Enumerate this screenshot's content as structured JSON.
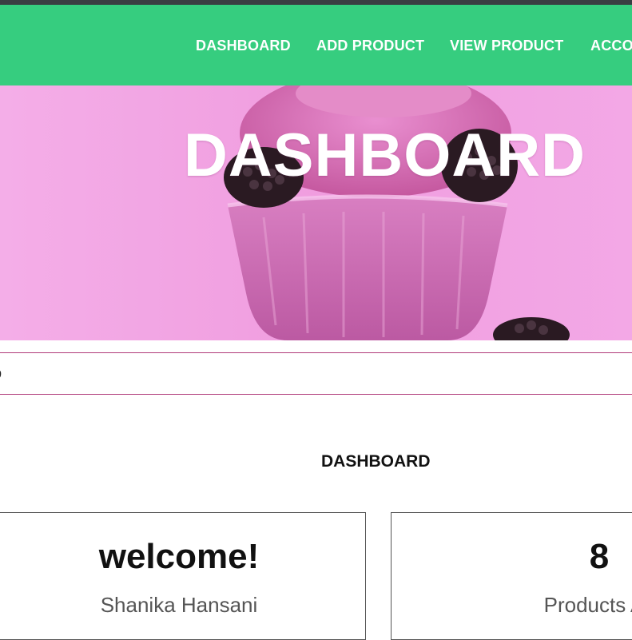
{
  "nav": {
    "items": [
      {
        "label": "DASHBOARD"
      },
      {
        "label": "ADD PRODUCT"
      },
      {
        "label": "VIEW PRODUCT"
      },
      {
        "label": "ACCO"
      }
    ]
  },
  "hero": {
    "title": "DASHBOARD"
  },
  "search": {
    "placeholder": "",
    "glyph": "p"
  },
  "main": {
    "section_title": "DASHBOARD",
    "cards": [
      {
        "big": "welcome!",
        "sub": "Shanika Hansani"
      },
      {
        "big": "8",
        "sub": "Products Ac"
      }
    ]
  },
  "colors": {
    "navbar": "#36cd7f",
    "hero_bg": "#f2a4e4",
    "search_border": "#b03a7a"
  }
}
